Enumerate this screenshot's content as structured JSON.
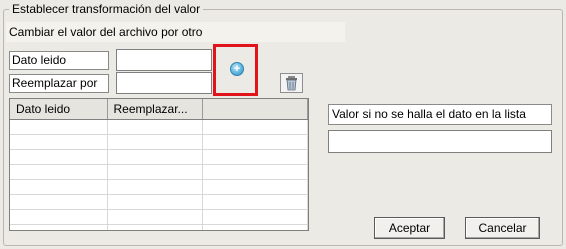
{
  "group": {
    "title": "Establecer transformación del valor"
  },
  "info": {
    "text": "Cambiar el valor del archivo por otro"
  },
  "form": {
    "dato_label": "Dato leido",
    "dato_value": "",
    "reemplazar_label": "Reemplazar por",
    "reemplazar_value": ""
  },
  "icons": {
    "add": "add-circle-icon",
    "delete": "trash-icon"
  },
  "table": {
    "columns": [
      "Dato leido",
      "Reemplazar...",
      ""
    ],
    "rows": [
      [
        "",
        "",
        ""
      ],
      [
        "",
        "",
        ""
      ],
      [
        "",
        "",
        ""
      ],
      [
        "",
        "",
        ""
      ],
      [
        "",
        "",
        ""
      ],
      [
        "",
        "",
        ""
      ],
      [
        "",
        "",
        ""
      ],
      [
        "",
        "",
        ""
      ]
    ]
  },
  "side": {
    "label": "Valor si no se halla el dato en la lista",
    "value": ""
  },
  "buttons": {
    "accept": "Aceptar",
    "cancel": "Cancelar"
  },
  "colors": {
    "highlight": "#e0141a",
    "add_icon": "#4aa8d8",
    "background": "#eceae4"
  }
}
